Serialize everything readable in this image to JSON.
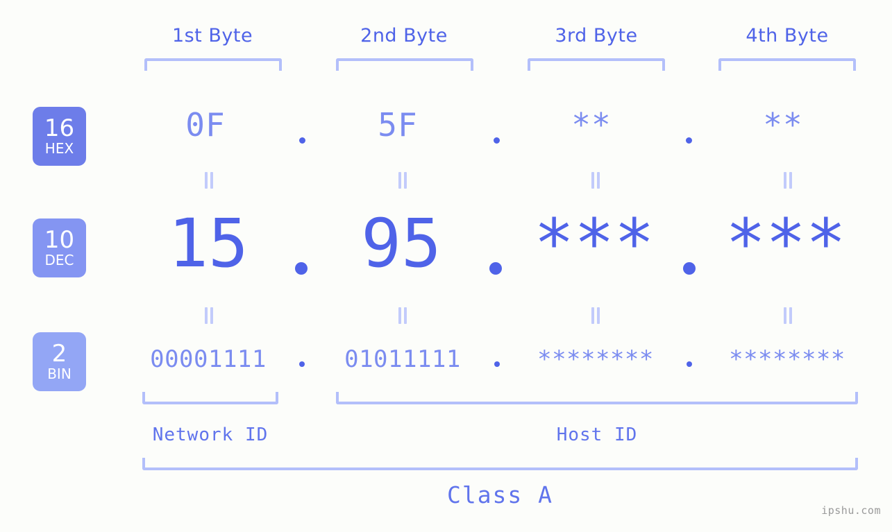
{
  "diagram": {
    "title_class": "Class A",
    "watermark": "ipshu.com",
    "colors": {
      "background": "#fcfdfa",
      "accent_strong": "#4f63e8",
      "accent_mid": "#7b8cf0",
      "accent_light": "#b3bffa",
      "badge_hex": "#6d7de9",
      "badge_dec": "#8495f2",
      "badge_bin": "#93a6f5",
      "watermark": "#9a9a9a"
    }
  },
  "byte_headers": [
    {
      "label": "1st Byte"
    },
    {
      "label": "2nd Byte"
    },
    {
      "label": "3rd Byte"
    },
    {
      "label": "4th Byte"
    }
  ],
  "rows": [
    {
      "badge_number": "16",
      "badge_name": "HEX",
      "values": [
        "0F",
        "5F",
        "**",
        "**"
      ],
      "separator": "."
    },
    {
      "badge_number": "10",
      "badge_name": "DEC",
      "values": [
        "15",
        "95",
        "***",
        "***"
      ],
      "separator": "."
    },
    {
      "badge_number": "2",
      "badge_name": "BIN",
      "values": [
        "00001111",
        "01011111",
        "********",
        "********"
      ],
      "separator": "."
    }
  ],
  "equals_symbol": "=",
  "sections": [
    {
      "label": "Network ID"
    },
    {
      "label": "Host ID"
    }
  ],
  "class_label": "Class A"
}
